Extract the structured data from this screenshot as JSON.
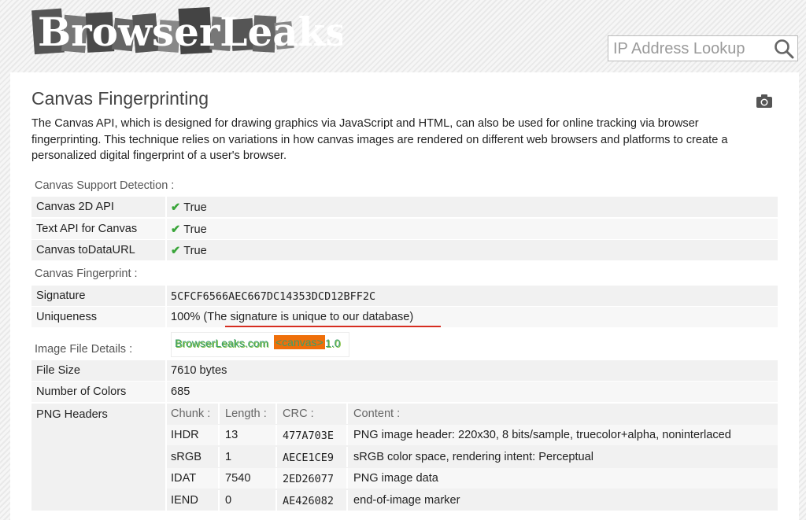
{
  "header": {
    "logo_text": "BrowserLeaks.com",
    "search_placeholder": "IP Address Lookup"
  },
  "page": {
    "title": "Canvas Fingerprinting",
    "description": "The Canvas API, which is designed for drawing graphics via JavaScript and HTML, can also be used for online tracking via browser fingerprinting. This technique relies on variations in how canvas images are rendered on different web browsers and platforms to create a personalized digital fingerprint of a user's browser."
  },
  "support": {
    "label": "Canvas Support Detection :",
    "rows": [
      {
        "key": "Canvas 2D API",
        "value": "True"
      },
      {
        "key": "Text API for Canvas",
        "value": "True"
      },
      {
        "key": "Canvas toDataURL",
        "value": "True"
      }
    ]
  },
  "fingerprint": {
    "label": "Canvas Fingerprint :",
    "signature_key": "Signature",
    "signature_value": "5CFCF6566AEC667DC14353DCD12BFF2C",
    "uniqueness_key": "Uniqueness",
    "uniqueness_value": "100% (The signature is unique to our database)"
  },
  "image": {
    "label": "Image File Details :",
    "canvas_text_1": "BrowserLeaks.com",
    "canvas_text_2": "<canvas>",
    "canvas_text_3": "1.0",
    "file_size_key": "File Size",
    "file_size_value": "7610 bytes",
    "colors_key": "Number of Colors",
    "colors_value": "685",
    "png_key": "PNG Headers",
    "png_headers": {
      "columns": [
        "Chunk :",
        "Length :",
        "CRC :",
        "Content :"
      ],
      "rows": [
        [
          "IHDR",
          "13",
          "477A703E",
          "PNG image header: 220x30, 8 bits/sample, truecolor+alpha, noninterlaced"
        ],
        [
          "sRGB",
          "1",
          "AECE1CE9",
          "sRGB color space, rendering intent: Perceptual"
        ],
        [
          "IDAT",
          "7540",
          "2ED26077",
          "PNG image data"
        ],
        [
          "IEND",
          "0",
          "AE426082",
          "end-of-image marker"
        ]
      ]
    }
  },
  "colors": {
    "check": "#3aa53a",
    "underline": "#d62d20",
    "canvas_orange": "#ef6f0a"
  }
}
